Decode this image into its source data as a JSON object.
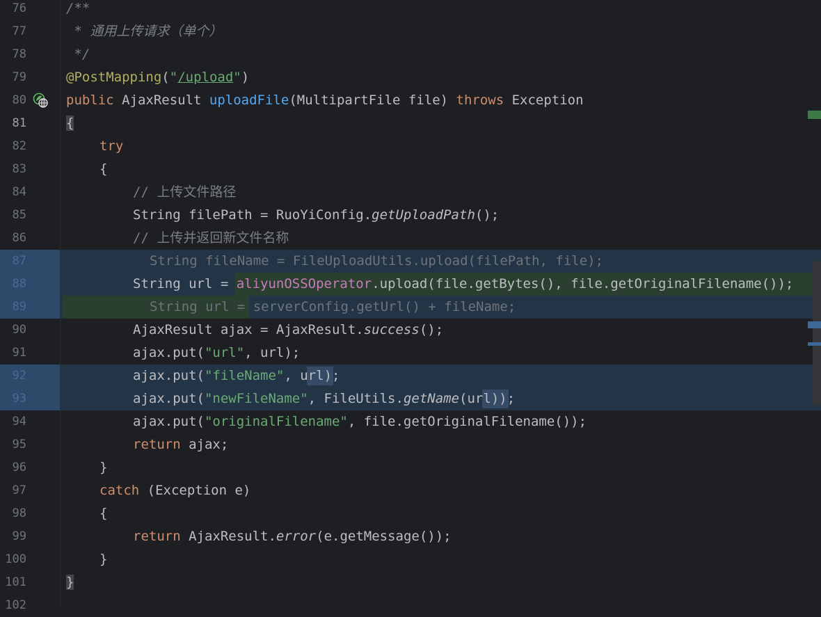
{
  "editor": {
    "lines": [
      {
        "no": "76"
      },
      {
        "no": "77"
      },
      {
        "no": "78"
      },
      {
        "no": "79"
      },
      {
        "no": "80"
      },
      {
        "no": "81"
      },
      {
        "no": "82"
      },
      {
        "no": "83"
      },
      {
        "no": "84"
      },
      {
        "no": "85"
      },
      {
        "no": "86"
      },
      {
        "no": "87"
      },
      {
        "no": "88"
      },
      {
        "no": "89"
      },
      {
        "no": "90"
      },
      {
        "no": "91"
      },
      {
        "no": "92"
      },
      {
        "no": "93"
      },
      {
        "no": "94"
      },
      {
        "no": "95"
      },
      {
        "no": "96"
      },
      {
        "no": "97"
      },
      {
        "no": "98"
      },
      {
        "no": "99"
      },
      {
        "no": "100"
      },
      {
        "no": "101"
      },
      {
        "no": "102"
      }
    ],
    "code": {
      "l76": "/**",
      "l77": " * 通用上传请求（单个）",
      "l78": " */",
      "l79_ann": "@PostMapping",
      "l79_open": "(",
      "l79_str": "\"/upload\"",
      "l79_close": ")",
      "l80_public": "public",
      "l80_type": " AjaxResult ",
      "l80_fn": "uploadFile",
      "l80_params": "(MultipartFile file) ",
      "l80_throws": "throws",
      "l80_exc": " Exception",
      "l81": "{",
      "l82": "try",
      "l83": "{",
      "l84": "// 上传文件路径",
      "l85_a": "String filePath = RuoYiConfig.",
      "l85_b": "getUploadPath",
      "l85_c": "();",
      "l86": "// 上传并返回新文件名称",
      "l87": "String fileName = FileUploadUtils.upload(filePath, file);",
      "l88_a": "String url = ",
      "l88_b": "aliyunOSSOperator",
      "l88_c": ".upload(file.getBytes(), file.getOriginalFilename());",
      "l89_a": "String url = ",
      "l89_b": "serverConfig.getUrl() + fileName;",
      "l90_a": "AjaxResult ajax = AjaxResult.",
      "l90_b": "success",
      "l90_c": "();",
      "l91_a": "ajax.put(",
      "l91_s": "\"url\"",
      "l91_c": ", url);",
      "l92_a": "ajax.put(",
      "l92_s": "\"fileName\"",
      "l92_c": ", ",
      "l92_u": "url",
      "l92_d": ");",
      "l93_a": "ajax.put(",
      "l93_s": "\"newFileName\"",
      "l93_c": ", FileUtils.",
      "l93_f": "getName",
      "l93_p": "(",
      "l93_u": "url",
      "l93_d": "));",
      "l94_a": "ajax.put(",
      "l94_s": "\"originalFilename\"",
      "l94_c": ", file.getOriginalFilename());",
      "l95_r": "return",
      "l95_c": " ajax;",
      "l96": "}",
      "l97_k": "catch",
      "l97_c": " (Exception e)",
      "l98": "{",
      "l99_r": "return",
      "l99_a": " AjaxResult.",
      "l99_f": "error",
      "l99_c": "(e.getMessage());",
      "l100": "}",
      "l101": "}"
    },
    "gutter_icon": "spring-web-endpoint-icon",
    "colors": {
      "keyword": "#cf8e6d",
      "string": "#6aab73",
      "annotation": "#b3ae60",
      "function": "#56a8f5",
      "field": "#c77dbb",
      "comment": "#7a7e85",
      "background": "#1e1f22"
    }
  }
}
